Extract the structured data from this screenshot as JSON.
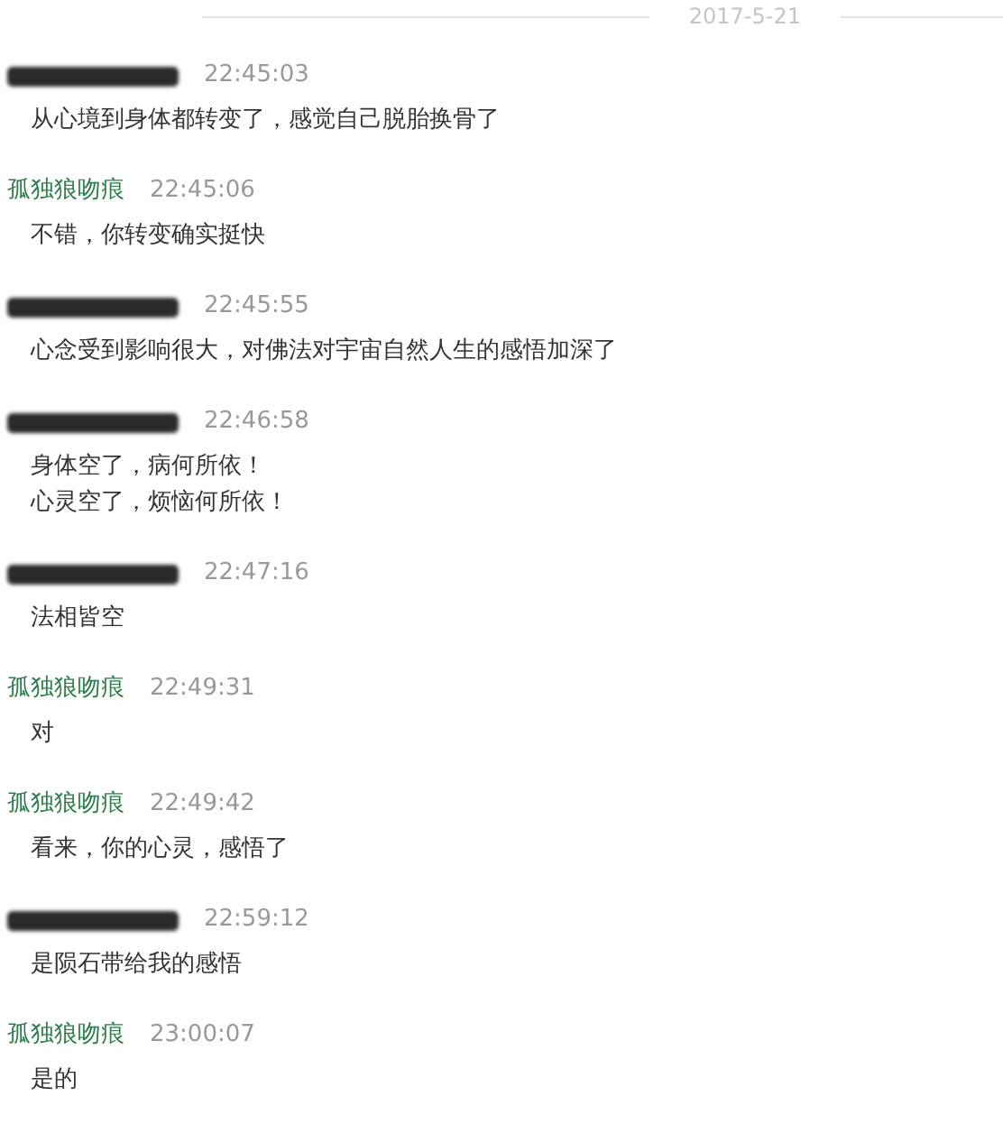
{
  "date": "2017-5-21",
  "messages": [
    {
      "sender": {
        "kind": "redacted"
      },
      "time": "22:45:03",
      "lines": [
        "从心境到身体都转变了，感觉自己脱胎换骨了"
      ]
    },
    {
      "sender": {
        "kind": "named",
        "name": "孤独狼吻痕"
      },
      "time": "22:45:06",
      "lines": [
        "不错，你转变确实挺快"
      ]
    },
    {
      "sender": {
        "kind": "redacted"
      },
      "time": "22:45:55",
      "lines": [
        "心念受到影响很大，对佛法对宇宙自然人生的感悟加深了"
      ]
    },
    {
      "sender": {
        "kind": "redacted"
      },
      "time": "22:46:58",
      "lines": [
        "身体空了，病何所依！",
        "心灵空了，烦恼何所依！"
      ]
    },
    {
      "sender": {
        "kind": "redacted"
      },
      "time": "22:47:16",
      "lines": [
        "法相皆空"
      ]
    },
    {
      "sender": {
        "kind": "named",
        "name": "孤独狼吻痕"
      },
      "time": "22:49:31",
      "lines": [
        "对"
      ]
    },
    {
      "sender": {
        "kind": "named",
        "name": "孤独狼吻痕"
      },
      "time": "22:49:42",
      "lines": [
        "看来，你的心灵，感悟了"
      ]
    },
    {
      "sender": {
        "kind": "redacted"
      },
      "time": "22:59:12",
      "lines": [
        "是陨石带给我的感悟"
      ]
    },
    {
      "sender": {
        "kind": "named",
        "name": "孤独狼吻痕"
      },
      "time": "23:00:07",
      "lines": [
        "是的"
      ]
    }
  ]
}
